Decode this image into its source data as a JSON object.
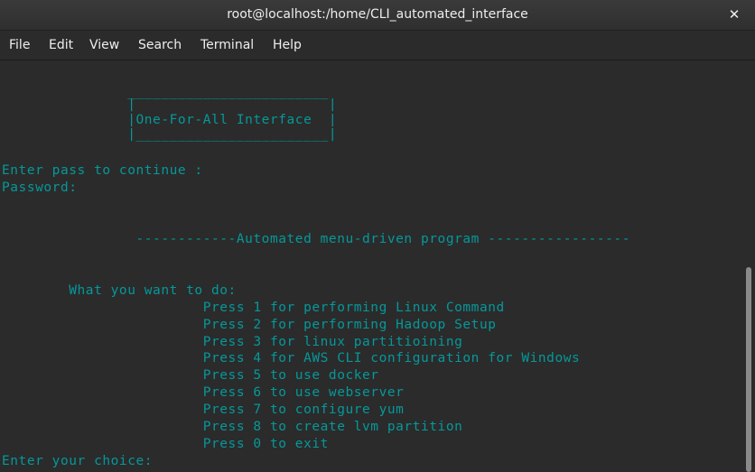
{
  "window": {
    "title": "root@localhost:/home/CLI_automated_interface",
    "close_glyph": "✕"
  },
  "menubar": {
    "items": [
      "File",
      "Edit",
      "View",
      "Search",
      "Terminal",
      "Help"
    ]
  },
  "terminal": {
    "text_color": "#06989a",
    "background": "#2b2b2b",
    "lines": [
      "               ________________________",
      "               |                       |",
      "               |One-For-All Interface  |",
      "               |_______________________|",
      "Enter pass to continue :",
      "Password:",
      "",
      "",
      "                ------------Automated menu-driven program -----------------",
      "",
      "",
      "        What you want to do:",
      "                        Press 1 for performing Linux Command",
      "                        Press 2 for performing Hadoop Setup",
      "                        Press 3 for linux partitioining",
      "                        Press 4 for AWS CLI configuration for Windows",
      "                        Press 5 to use docker",
      "                        Press 6 to use webserver",
      "                        Press 7 to configure yum",
      "                        Press 8 to create lvm partition",
      "                        Press 0 to exit",
      "Enter your choice:"
    ]
  }
}
